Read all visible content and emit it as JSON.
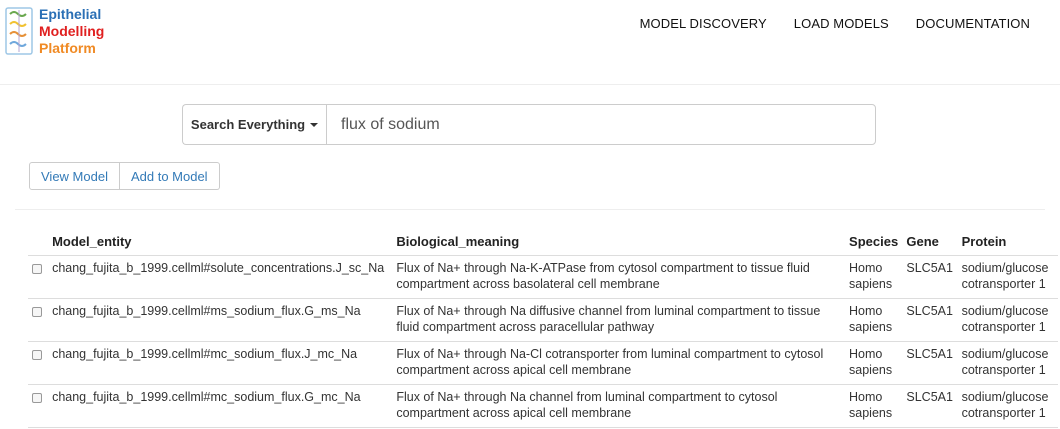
{
  "logo": {
    "line1": "Epithelial",
    "line2": "Modelling",
    "line3": "Platform"
  },
  "nav": {
    "items": [
      "MODEL DISCOVERY",
      "LOAD MODELS",
      "DOCUMENTATION"
    ]
  },
  "search": {
    "scope_label": "Search Everything",
    "query": "flux of sodium"
  },
  "actions": {
    "view_model": "View Model",
    "add_to_model": "Add to Model"
  },
  "table": {
    "headers": [
      "Model_entity",
      "Biological_meaning",
      "Species",
      "Gene",
      "Protein"
    ],
    "rows": [
      {
        "entity": "chang_fujita_b_1999.cellml#solute_concentrations.J_sc_Na",
        "meaning": "Flux of Na+ through Na-K-ATPase from cytosol compartment to tissue fluid compartment across basolateral cell membrane",
        "species": "Homo sapiens",
        "gene": "SLC5A1",
        "protein": "sodium/glucose cotransporter 1"
      },
      {
        "entity": "chang_fujita_b_1999.cellml#ms_sodium_flux.G_ms_Na",
        "meaning": "Flux of Na+ through Na diffusive channel from luminal compartment to tissue fluid compartment across paracellular pathway",
        "species": "Homo sapiens",
        "gene": "SLC5A1",
        "protein": "sodium/glucose cotransporter 1"
      },
      {
        "entity": "chang_fujita_b_1999.cellml#mc_sodium_flux.J_mc_Na",
        "meaning": "Flux of Na+ through Na-Cl cotransporter from luminal compartment to cytosol compartment across apical cell membrane",
        "species": "Homo sapiens",
        "gene": "SLC5A1",
        "protein": "sodium/glucose cotransporter 1"
      },
      {
        "entity": "chang_fujita_b_1999.cellml#mc_sodium_flux.G_mc_Na",
        "meaning": "Flux of Na+ through Na channel from luminal compartment to cytosol compartment across apical cell membrane",
        "species": "Homo sapiens",
        "gene": "SLC5A1",
        "protein": "sodium/glucose cotransporter 1"
      }
    ]
  },
  "colors": {
    "logo_blue": "#2a6fb5",
    "logo_red": "#e02020",
    "logo_orange": "#f08a24",
    "link_blue": "#337ab7"
  }
}
